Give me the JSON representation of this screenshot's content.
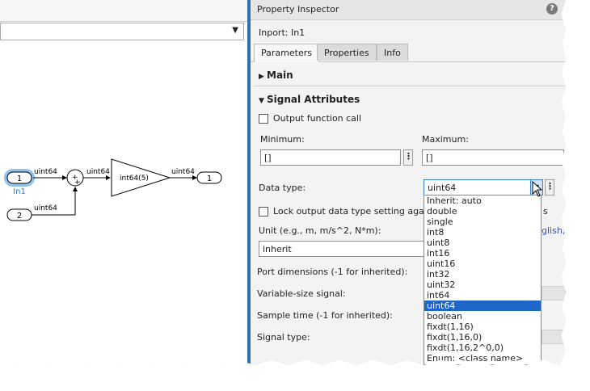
{
  "inspector": {
    "title": "Property Inspector",
    "help_icon": "help-icon",
    "block_name": "Inport: In1",
    "tabs": [
      {
        "label": "Parameters",
        "active": true
      },
      {
        "label": "Properties",
        "active": false
      },
      {
        "label": "Info",
        "active": false
      }
    ],
    "main_section": "Main",
    "signal_section": "Signal Attributes",
    "output_function_call": "Output function call",
    "minimum_label": "Minimum:",
    "minimum_value": "[]",
    "maximum_label": "Maximum:",
    "maximum_value": "[]",
    "data_type_label": "Data type:",
    "data_type_value": "uint64",
    "lock_label": "Lock output data type setting against",
    "lock_trailing": "s",
    "unit_label": "Unit (e.g., m, m/s^2, N*m):",
    "unit_link": "glish,",
    "unit_value": "inherit",
    "port_dimensions_label": "Port dimensions (-1 for inherited):",
    "variable_size_label": "Variable-size signal:",
    "sample_time_label": "Sample time (-1 for inherited):",
    "signal_type_label": "Signal type:"
  },
  "datatype_options": [
    "Inherit: auto",
    "double",
    "single",
    "int8",
    "uint8",
    "int16",
    "uint16",
    "int32",
    "uint32",
    "int64",
    "uint64",
    "boolean",
    "fixdt(1,16)",
    "fixdt(1,16,0)",
    "fixdt(1,16,2^0,0)",
    "Enum: <class name>"
  ],
  "selected_option_index": 10,
  "diagram": {
    "inport1_number": "1",
    "inport1_name": "In1",
    "inport2_number": "2",
    "outport_number": "1",
    "signal1_label": "uint64",
    "signal2_label": "uint64",
    "signal3_label": "uint64",
    "signal4_label": "uint64",
    "gain_label": "int64(5)",
    "sum_plus_top": "+",
    "sum_plus_bottom": "+"
  },
  "colors": {
    "accent": "#1f66c9",
    "selection_highlight": "#8fc0ef",
    "link": "#3a4fb8"
  }
}
